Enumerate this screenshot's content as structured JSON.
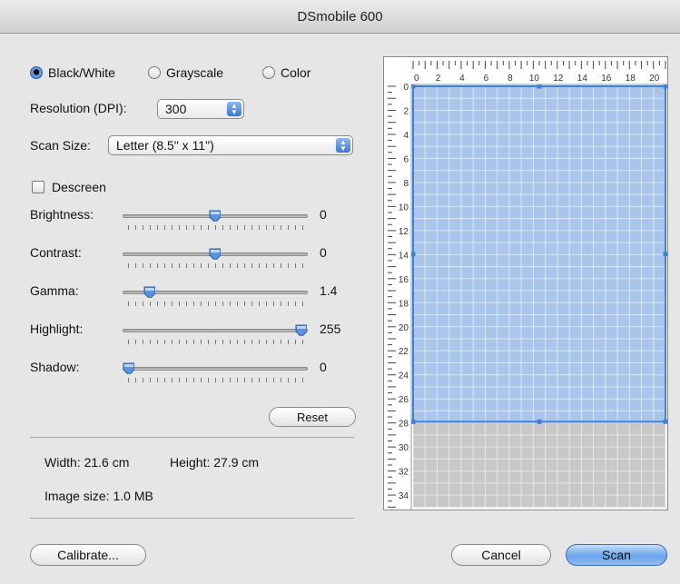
{
  "window": {
    "title": "DSmobile 600"
  },
  "mode": {
    "options": [
      {
        "label": "Black/White",
        "selected": true
      },
      {
        "label": "Grayscale",
        "selected": false
      },
      {
        "label": "Color",
        "selected": false
      }
    ]
  },
  "resolution": {
    "label": "Resolution (DPI):",
    "value": "300"
  },
  "scan_size": {
    "label": "Scan Size:",
    "value": "Letter (8.5\" x 11\")"
  },
  "descreen": {
    "label": "Descreen",
    "checked": false
  },
  "sliders": [
    {
      "label": "Brightness:",
      "value": "0",
      "fraction": 0.5
    },
    {
      "label": "Contrast:",
      "value": "0",
      "fraction": 0.5
    },
    {
      "label": "Gamma:",
      "value": "1.4",
      "fraction": 0.12
    },
    {
      "label": "Highlight:",
      "value": "255",
      "fraction": 1.0
    },
    {
      "label": "Shadow:",
      "value": "0",
      "fraction": 0.0
    }
  ],
  "reset_label": "Reset",
  "info": {
    "width": "Width: 21.6 cm",
    "height": "Height: 27.9 cm",
    "image_size": "Image size: 1.0 MB"
  },
  "buttons": {
    "calibrate": "Calibrate...",
    "cancel": "Cancel",
    "scan": "Scan"
  },
  "ruler": {
    "top": [
      "0",
      "2",
      "4",
      "6",
      "8",
      "10",
      "12",
      "14",
      "16",
      "18",
      "20"
    ],
    "left": [
      "0",
      "2",
      "4",
      "6",
      "8",
      "10",
      "12",
      "14",
      "16",
      "18",
      "20",
      "22",
      "24",
      "26",
      "28",
      "30",
      "32",
      "34"
    ]
  },
  "colors": {
    "selection": "#a9c6ea",
    "selection_border": "#3d82d8",
    "outside": "#c8c8c8"
  }
}
